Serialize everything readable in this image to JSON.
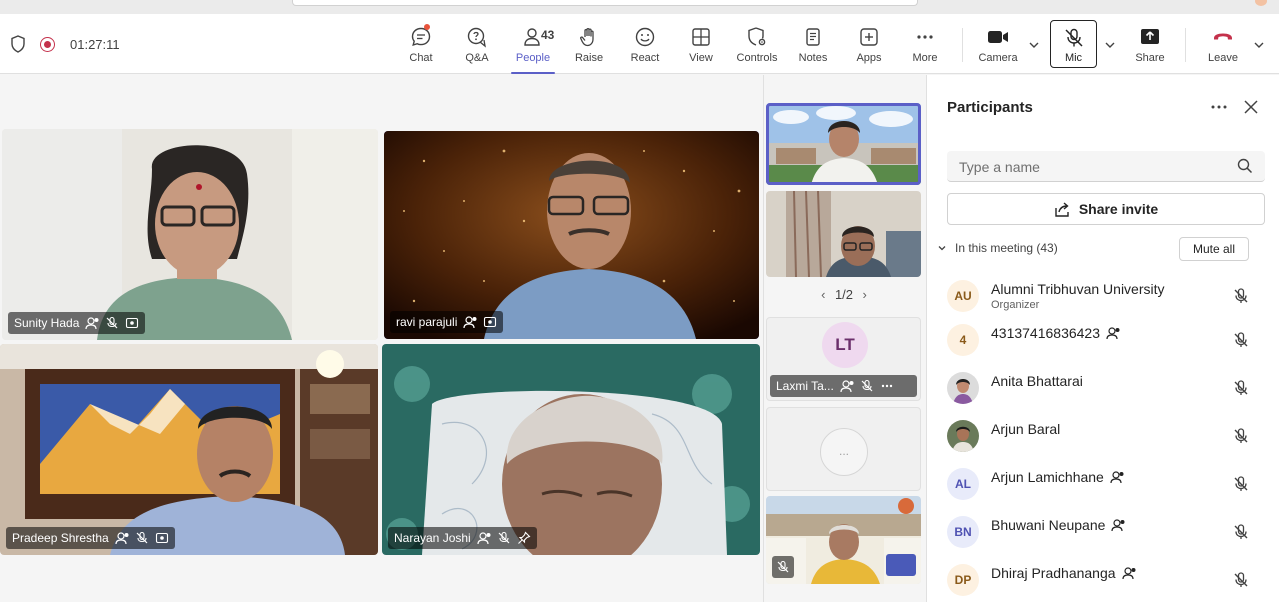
{
  "toolbar": {
    "timer": "01:27:11",
    "buttons": {
      "chat": "Chat",
      "qa": "Q&A",
      "people": "People",
      "people_count": "43",
      "raise": "Raise",
      "react": "React",
      "view": "View",
      "controls": "Controls",
      "notes": "Notes",
      "apps": "Apps",
      "more": "More",
      "camera": "Camera",
      "mic": "Mic",
      "share": "Share",
      "leave": "Leave"
    },
    "accent_color": "#5b5fc7",
    "leave_color": "#c4314b"
  },
  "stage": {
    "tiles": [
      {
        "name": "Sunity Hada"
      },
      {
        "name": "ravi parajuli"
      },
      {
        "name": "Pradeep Shrestha"
      },
      {
        "name": "Narayan Joshi"
      }
    ]
  },
  "filmstrip": {
    "pager": "1/2",
    "laxmi_initials": "LT",
    "laxmi_name": "Laxmi Ta...",
    "placeholder_glyph": "..."
  },
  "panel": {
    "title": "Participants",
    "search_placeholder": "Type a name",
    "share_invite": "Share invite",
    "section_label": "In this meeting (43)",
    "mute_all": "Mute all",
    "participants": [
      {
        "initials": "AU",
        "name": "Alumni Tribhuvan University",
        "sub": "Organizer",
        "bg": "#fdf1e1",
        "fg": "#8a5a1a"
      },
      {
        "initials": "4",
        "name": "43137416836423",
        "bg": "#fdf1e1",
        "fg": "#8a5a1a"
      },
      {
        "initials": "",
        "name": "Anita Bhattarai"
      },
      {
        "initials": "",
        "name": "Arjun Baral"
      },
      {
        "initials": "AL",
        "name": "Arjun Lamichhane",
        "bg": "#e8ebfa",
        "fg": "#4f52b2"
      },
      {
        "initials": "BN",
        "name": "Bhuwani Neupane",
        "bg": "#e8ebfa",
        "fg": "#4f52b2"
      },
      {
        "initials": "DP",
        "name": "Dhiraj Pradhananga",
        "bg": "#fdf1e1",
        "fg": "#8a5a1a"
      }
    ]
  }
}
